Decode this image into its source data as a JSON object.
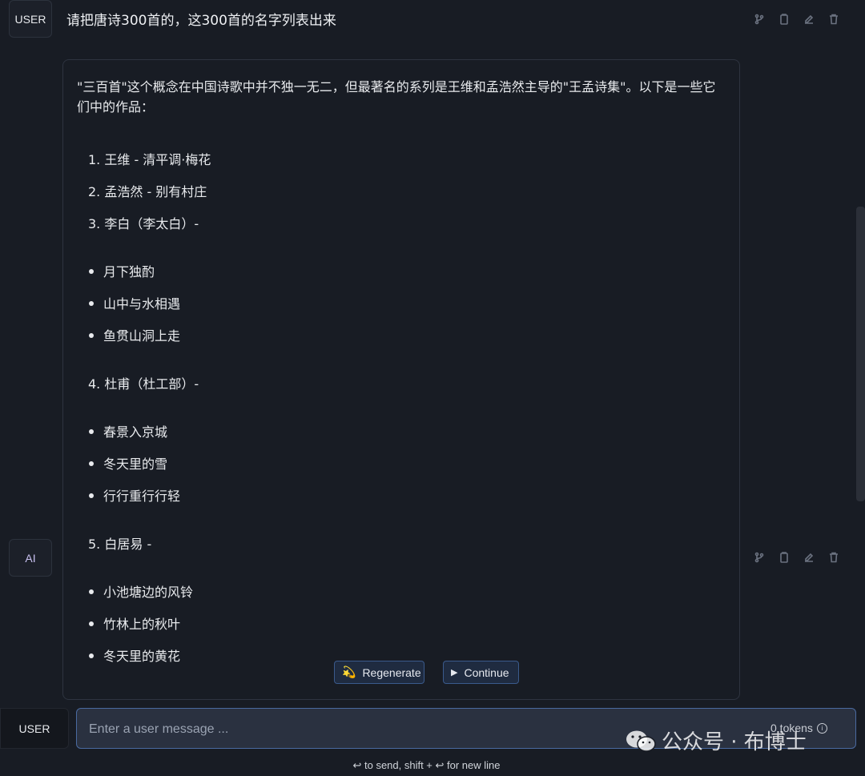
{
  "top_message": {
    "role": "USER",
    "text": "请把唐诗300首的，这300首的名字列表出来"
  },
  "ai_message": {
    "role": "AI",
    "intro": "\"三百首\"这个概念在中国诗歌中并不独一无二，但最著名的系列是王维和孟浩然主导的\"王孟诗集\"。以下是一些它们中的作品：",
    "lines": [
      "1. 王维 - 清平调·梅花",
      "2. 孟浩然 - 别有村庄",
      "3. 李白（李太白）-",
      "月下独酌",
      "山中与水相遇",
      "鱼贯山洞上走",
      "4. 杜甫（杜工部）-",
      "春景入京城",
      "冬天里的雪",
      "行行重行行轻",
      "5. 白居易 -",
      "小池塘边的风铃",
      "竹林上的秋叶",
      "冬天里的黄花"
    ]
  },
  "message_actions": [
    "branch-icon",
    "copy-icon",
    "edit-icon",
    "delete-icon"
  ],
  "buttons": {
    "regenerate": "Regenerate",
    "continue": "Continue"
  },
  "input": {
    "role": "USER",
    "placeholder": "Enter a user message ...",
    "value": "",
    "token_count": "0 tokens"
  },
  "hint": "↩ to send, shift + ↩ for new line",
  "watermark": "公众号 · 布博士",
  "colors": {
    "background": "#181c24",
    "accent": "#4a6aa0",
    "button_bg": "#1f2b40"
  }
}
